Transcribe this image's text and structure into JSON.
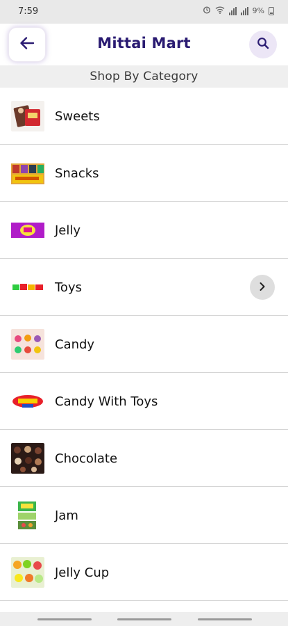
{
  "status_bar": {
    "time": "7:59",
    "battery_text": "9%"
  },
  "app_bar": {
    "title": "Mittai Mart",
    "back_icon": "arrow-left-icon",
    "search_icon": "search-icon",
    "accent_color": "#2a1b72"
  },
  "section": {
    "title": "Shop By Category"
  },
  "categories": [
    {
      "label": "Sweets",
      "thumbnail": "sweets-thumbnail"
    },
    {
      "label": "Snacks",
      "thumbnail": "snacks-thumbnail"
    },
    {
      "label": "Jelly",
      "thumbnail": "jelly-thumbnail"
    },
    {
      "label": "Toys",
      "thumbnail": "toys-thumbnail",
      "has_chevron": true
    },
    {
      "label": "Candy",
      "thumbnail": "candy-thumbnail"
    },
    {
      "label": "Candy With Toys",
      "thumbnail": "candy-with-toys-thumbnail"
    },
    {
      "label": "Chocolate",
      "thumbnail": "chocolate-thumbnail"
    },
    {
      "label": "Jam",
      "thumbnail": "jam-thumbnail"
    },
    {
      "label": "Jelly Cup",
      "thumbnail": "jelly-cup-thumbnail"
    }
  ]
}
